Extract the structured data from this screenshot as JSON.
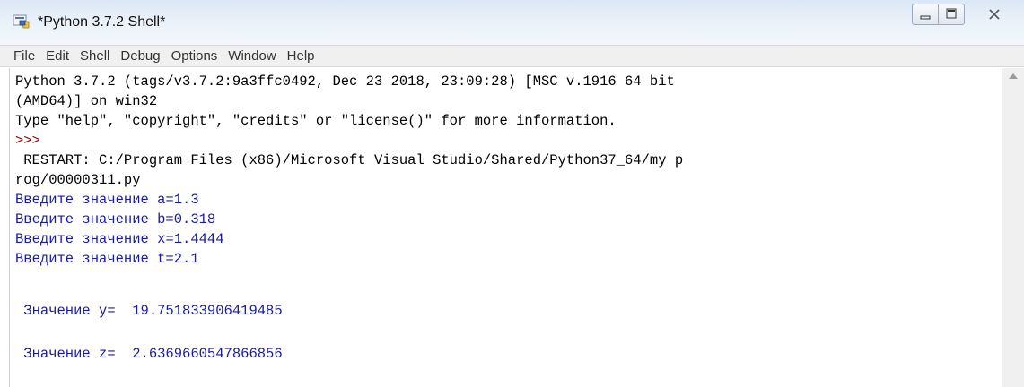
{
  "window": {
    "title": "*Python 3.7.2 Shell*",
    "app_icon": "python-idle-icon"
  },
  "menu": [
    "File",
    "Edit",
    "Shell",
    "Debug",
    "Options",
    "Window",
    "Help"
  ],
  "shell_lines": [
    "Python 3.7.2 (tags/v3.7.2:9a3ffc0492, Dec 23 2018, 23:09:28) [MSC v.1916 64 bit",
    "(AMD64)] on win32",
    "Type \"help\", \"copyright\", \"credits\" or \"license()\" for more information.",
    ">>>",
    " RESTART: C:/Program Files (x86)/Microsoft Visual Studio/Shared/Python37_64/my p",
    "rog/00000311.py",
    "Введите значение a=1.3",
    "Введите значение b=0.318",
    "Введите значение x=1.4444",
    "Введите значение t=2.1",
    " Значение y=  19.751833906419485",
    " Значение z=  2.6369660547866856"
  ],
  "colors": {
    "stdout": "#000000",
    "program_output": "#1a1aa6",
    "prompt": "#8b0000"
  }
}
